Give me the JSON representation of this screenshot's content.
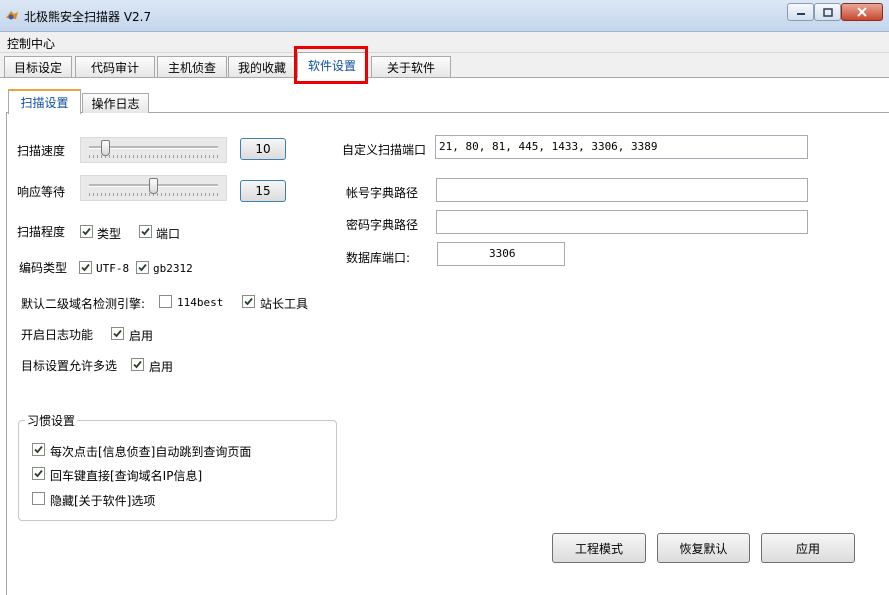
{
  "window": {
    "title": "北极熊安全扫描器 V2.7",
    "icon": "bear-app-icon",
    "controls": [
      "minimize-icon",
      "maximize-icon",
      "close-icon"
    ]
  },
  "menu": {
    "label": "控制中心"
  },
  "tabs": [
    {
      "label": "目标设定",
      "active": false
    },
    {
      "label": "代码审计",
      "active": false
    },
    {
      "label": "主机侦查",
      "active": false
    },
    {
      "label": "我的收藏",
      "active": false
    },
    {
      "label": "软件设置",
      "active": true
    },
    {
      "label": "关于软件",
      "active": false
    }
  ],
  "subtabs": [
    {
      "label": "扫描设置",
      "active": true
    },
    {
      "label": "操作日志",
      "active": false
    }
  ],
  "settings": {
    "scan_speed": {
      "label": "扫描速度",
      "value": "10",
      "level": 0.1
    },
    "response_wait": {
      "label": "响应等待",
      "value": "15",
      "level": 0.5
    },
    "scan_level": {
      "label": "扫描程度",
      "options": [
        {
          "label": "类型",
          "checked": true
        },
        {
          "label": "端口",
          "checked": true
        }
      ]
    },
    "encoding": {
      "label": "编码类型",
      "options": [
        {
          "label": "UTF-8",
          "checked": true
        },
        {
          "label": "gb2312",
          "checked": true
        }
      ]
    },
    "subdomain_engine": {
      "label": "默认二级域名检测引擎:",
      "options": [
        {
          "label": "114best",
          "checked": false
        },
        {
          "label": "站长工具",
          "checked": true
        }
      ]
    },
    "enable_log": {
      "label": "开启日志功能",
      "option": "启用",
      "checked": true
    },
    "multi_select": {
      "label": "目标设置允许多选",
      "option": "启用",
      "checked": true
    }
  },
  "right": {
    "ports": {
      "label": "自定义扫描端口",
      "value": "21, 80, 81, 445, 1433, 3306, 3389"
    },
    "user_dict": {
      "label": "帐号字典路径",
      "value": ""
    },
    "pass_dict": {
      "label": "密码字典路径",
      "value": ""
    },
    "db_port": {
      "label": "数据库端口:",
      "value": "3306"
    }
  },
  "habits": {
    "title": "习惯设置",
    "items": [
      {
        "label": "每次点击[信息侦查]自动跳到查询页面",
        "checked": true
      },
      {
        "label": "回车键直接[查询域名IP信息]",
        "checked": true
      },
      {
        "label": "隐藏[关于软件]选项",
        "checked": false
      }
    ]
  },
  "buttons": {
    "engineering": "工程模式",
    "restore": "恢复默认",
    "apply": "应用"
  }
}
